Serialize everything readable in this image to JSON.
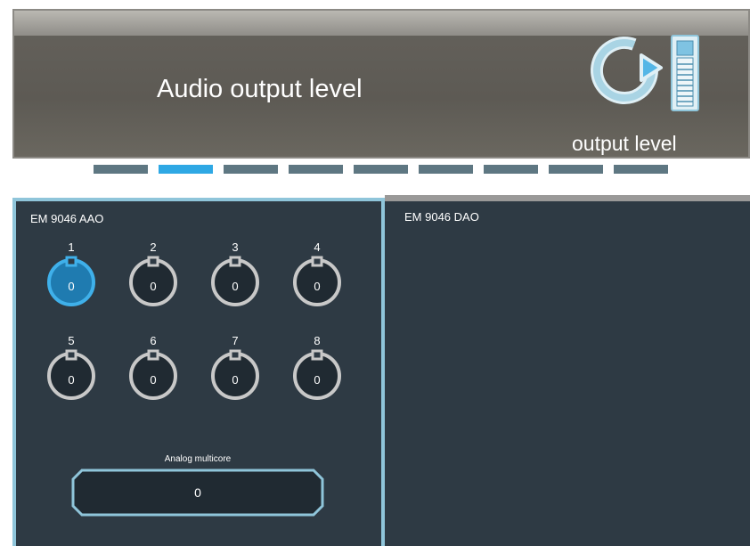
{
  "header": {
    "title": "Audio output level",
    "subtitle": "output level",
    "icon": "output-level-icon"
  },
  "pager": {
    "count": 9,
    "active_index": 1,
    "colors": {
      "active": "#2ea8e4",
      "inactive": "#5e7782"
    }
  },
  "panels": {
    "aao": {
      "title": "EM 9046 AAO",
      "knobs": [
        {
          "label": "1",
          "value": "0",
          "selected": true
        },
        {
          "label": "2",
          "value": "0",
          "selected": false
        },
        {
          "label": "3",
          "value": "0",
          "selected": false
        },
        {
          "label": "4",
          "value": "0",
          "selected": false
        },
        {
          "label": "5",
          "value": "0",
          "selected": false
        },
        {
          "label": "6",
          "value": "0",
          "selected": false
        },
        {
          "label": "7",
          "value": "0",
          "selected": false
        },
        {
          "label": "8",
          "value": "0",
          "selected": false
        }
      ],
      "multicore": {
        "label": "Analog multicore",
        "value": "0"
      }
    },
    "dao": {
      "title": "EM 9046 DAO"
    }
  },
  "colors": {
    "panel_bg": "#2e3a44",
    "selected_border": "#8fc5da",
    "knob_ring": "#c8c8c8",
    "knob_ring_selected": "#3fb0ea",
    "knob_fill": "#202a32",
    "knob_fill_selected": "#1f7bb0"
  }
}
